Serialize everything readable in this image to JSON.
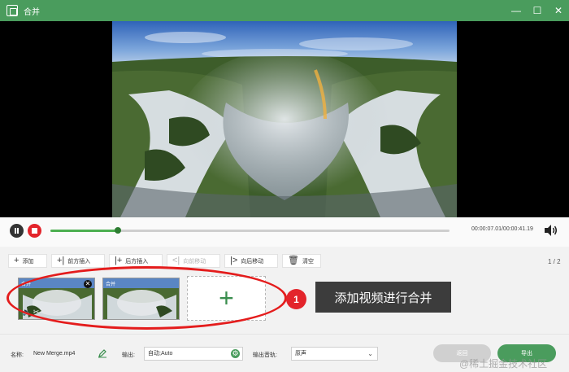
{
  "window": {
    "title": "合并",
    "minimize_icon": "minimize-icon",
    "maximize_icon": "maximize-icon",
    "close_icon": "close-icon"
  },
  "player": {
    "time": "00:00:07.01/00:00:41.19",
    "progress": 0.17
  },
  "toolbar": {
    "add": "添加",
    "insert_before": "前方插入",
    "insert_after": "后方插入",
    "move_forward": "向前移动",
    "move_backward": "向后移动",
    "clear": "清空",
    "page": "1 / 2"
  },
  "clips": [
    {
      "label": "合并",
      "selected": true
    },
    {
      "label": "合并",
      "selected": false
    }
  ],
  "callout": {
    "number": "1",
    "text": "添加视频进行合并"
  },
  "footer": {
    "name_label": "名称:",
    "name_value": "New Merge.mp4",
    "output_label": "输出:",
    "output_value": "自动;Auto",
    "audio_label": "输出音轨:",
    "audio_value": "原声",
    "back": "返回",
    "export": "导出"
  },
  "watermark": "@稀土掘金技术社区",
  "colors": {
    "accent": "#4a9c5d",
    "stop": "#e3242b",
    "highlight": "#e41c1c"
  }
}
